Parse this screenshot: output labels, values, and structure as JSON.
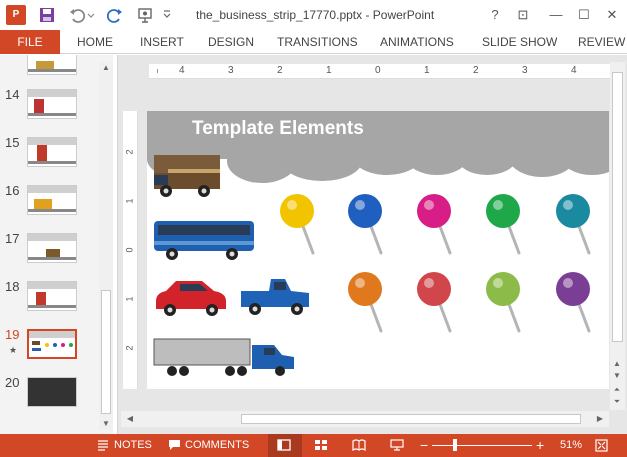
{
  "window": {
    "title": "the_business_strip_17770.pptx - PowerPoint",
    "app_logo": "P",
    "help": "?",
    "ribbon_display": "⊡",
    "minimize": "—",
    "maximize": "☐",
    "close": "✕"
  },
  "ribbon": {
    "file_label": "FILE",
    "tabs": [
      "HOME",
      "INSERT",
      "DESIGN",
      "TRANSITIONS",
      "ANIMATIONS",
      "SLIDE SHOW",
      "REVIEW"
    ]
  },
  "thumbnails": {
    "items": [
      {
        "number": "14"
      },
      {
        "number": "15"
      },
      {
        "number": "16"
      },
      {
        "number": "17"
      },
      {
        "number": "18"
      },
      {
        "number": "19"
      },
      {
        "number": "20"
      }
    ],
    "active_number": "19",
    "star": "★"
  },
  "ruler": {
    "h_labels": [
      "4",
      "3",
      "2",
      "1",
      "0",
      "1",
      "2",
      "3",
      "4"
    ],
    "v_labels": [
      "2",
      "1",
      "0",
      "1",
      "2"
    ]
  },
  "slide": {
    "title": "Template Elements",
    "pin_colors": [
      "#f2c400",
      "#1f5fbf",
      "#d81e86",
      "#1ea84a",
      "#1a8aa0",
      "#e0781e",
      "#d0464a",
      "#8cbb4a",
      "#7a3f95"
    ]
  },
  "statusbar": {
    "notes_label": "NOTES",
    "comments_label": "COMMENTS",
    "zoom_minus": "−",
    "zoom_plus": "+",
    "zoom_level": "51%",
    "zoom_fraction": 0.23
  },
  "colors": {
    "accent": "#d24726"
  }
}
